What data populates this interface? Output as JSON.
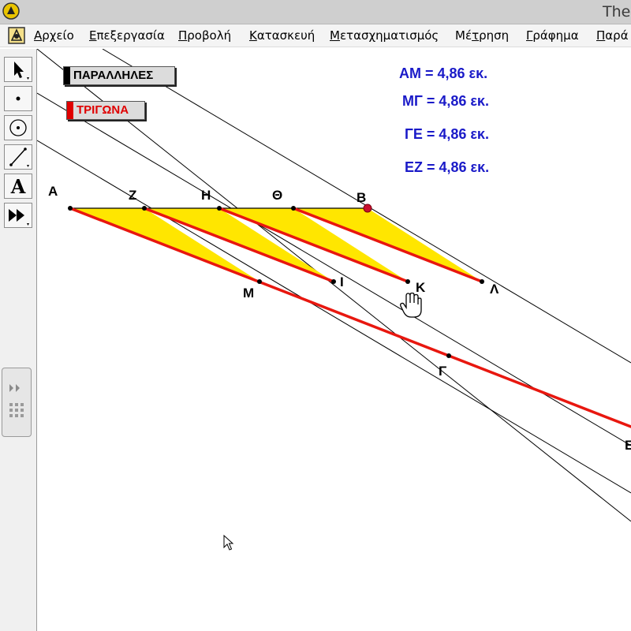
{
  "window": {
    "title": "The"
  },
  "menu": [
    {
      "pre": "",
      "ul": "Α",
      "post": "ρχείο"
    },
    {
      "pre": "",
      "ul": "Ε",
      "post": "πεξεργασία"
    },
    {
      "pre": "",
      "ul": "Π",
      "post": "ροβολή"
    },
    {
      "pre": "",
      "ul": "Κ",
      "post": "ατασκευή"
    },
    {
      "pre": "",
      "ul": "Μ",
      "post": "ετασχηματισμός"
    },
    {
      "pre": "Μέ",
      "ul": "τ",
      "post": "ρηση"
    },
    {
      "pre": "",
      "ul": "Γ",
      "post": "ράφημα"
    },
    {
      "pre": "",
      "ul": "Π",
      "post": "αρά"
    }
  ],
  "tools": [
    {
      "name": "selection-arrow-tool-icon"
    },
    {
      "name": "point-tool-icon"
    },
    {
      "name": "compass-tool-icon"
    },
    {
      "name": "straightedge-tool-icon"
    },
    {
      "name": "text-tool-icon"
    },
    {
      "name": "custom-tool-icon"
    }
  ],
  "buttons": {
    "parallels": "ΠΑΡΑΛΛΗΛΕΣ",
    "triangles": "ΤΡΙΓΩΝΑ"
  },
  "measurements": [
    "ΑΜ = 4,86 εκ.",
    "ΜΓ = 4,86 εκ.",
    "ΓΕ = 4,86 εκ.",
    "ΕΖ = 4,86 εκ."
  ],
  "points": {
    "A": "Α",
    "Z": "Ζ",
    "H": "Η",
    "Th": "Θ",
    "B": "Β",
    "M": "Μ",
    "I": "Ι",
    "K": "Κ",
    "L": "Λ",
    "G": "Γ",
    "E": "Ε"
  },
  "colors": {
    "triangle_fill": "#ffe600",
    "red_line": "#e8170f",
    "measure_text": "#1a1ac8",
    "thin_line": "#000000"
  }
}
